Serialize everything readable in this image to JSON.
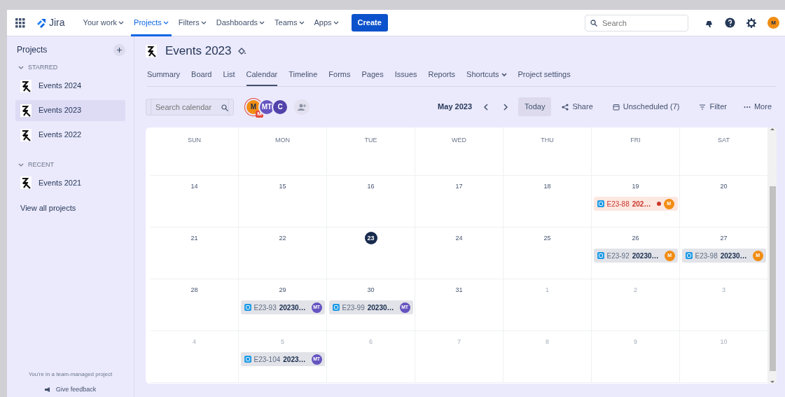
{
  "topnav": {
    "product": "Jira",
    "items": [
      {
        "label": "Your work",
        "selected": false
      },
      {
        "label": "Projects",
        "selected": true
      },
      {
        "label": "Filters",
        "selected": false
      },
      {
        "label": "Dashboards",
        "selected": false
      },
      {
        "label": "Teams",
        "selected": false
      },
      {
        "label": "Apps",
        "selected": false
      }
    ],
    "create": "Create",
    "search": {
      "placeholder": "Search"
    },
    "avatar": "M"
  },
  "sidebar": {
    "title": "Projects",
    "sections": [
      {
        "label": "STARRED",
        "expanded": true,
        "items": [
          {
            "label": "Events 2024",
            "selected": false
          },
          {
            "label": "Events 2023",
            "selected": true
          },
          {
            "label": "Events 2022",
            "selected": false
          }
        ]
      },
      {
        "label": "RECENT",
        "expanded": true,
        "items": [
          {
            "label": "Events 2021",
            "selected": false
          }
        ]
      }
    ],
    "view_all": "View all projects",
    "footer_note": "You're in a team-managed project",
    "feedback": "Give feedback"
  },
  "project": {
    "title": "Events 2023",
    "tabs": [
      {
        "label": "Summary",
        "selected": false
      },
      {
        "label": "Board",
        "selected": false
      },
      {
        "label": "List",
        "selected": false
      },
      {
        "label": "Calendar",
        "selected": true
      },
      {
        "label": "Timeline",
        "selected": false
      },
      {
        "label": "Forms",
        "selected": false
      },
      {
        "label": "Pages",
        "selected": false
      },
      {
        "label": "Issues",
        "selected": false
      },
      {
        "label": "Reports",
        "selected": false
      },
      {
        "label": "Shortcuts",
        "selected": false,
        "dropdown": true
      },
      {
        "label": "Project settings",
        "selected": false
      }
    ]
  },
  "toolbar": {
    "search": {
      "placeholder": "Search calendar"
    },
    "avatars": [
      {
        "initials": "M",
        "color": "#f18d13",
        "badge": "M"
      },
      {
        "initials": "MT",
        "color": "#6554c0"
      },
      {
        "initials": "C",
        "color": "#5243aa"
      }
    ],
    "month": "May 2023",
    "today": "Today",
    "share": "Share",
    "unscheduled": "Unscheduled (7)",
    "filter": "Filter",
    "more": "More"
  },
  "calendar": {
    "weekdays": [
      "SUN",
      "MON",
      "TUE",
      "WED",
      "THU",
      "FRI",
      "SAT"
    ],
    "weeks": [
      [
        {
          "day": "14",
          "outside": false,
          "today": false
        },
        {
          "day": "15",
          "outside": false,
          "today": false
        },
        {
          "day": "16",
          "outside": false,
          "today": false
        },
        {
          "day": "17",
          "outside": false,
          "today": false
        },
        {
          "day": "18",
          "outside": false,
          "today": false
        },
        {
          "day": "19",
          "outside": false,
          "today": false,
          "events": [
            {
              "key": "E23-88",
              "summary": "202…",
              "overdue": true,
              "assignee": "M",
              "color": "#f18d13"
            }
          ]
        },
        {
          "day": "20",
          "outside": false,
          "today": false
        }
      ],
      [
        {
          "day": "21",
          "outside": false,
          "today": false
        },
        {
          "day": "22",
          "outside": false,
          "today": false
        },
        {
          "day": "23",
          "outside": false,
          "today": true
        },
        {
          "day": "24",
          "outside": false,
          "today": false
        },
        {
          "day": "25",
          "outside": false,
          "today": false
        },
        {
          "day": "26",
          "outside": false,
          "today": false,
          "events": [
            {
              "key": "E23-92",
              "summary": "20230…",
              "overdue": false,
              "assignee": "M",
              "color": "#f18d13"
            }
          ]
        },
        {
          "day": "27",
          "outside": false,
          "today": false,
          "events": [
            {
              "key": "E23-98",
              "summary": "20230…",
              "overdue": false,
              "assignee": "M",
              "color": "#f18d13"
            }
          ]
        }
      ],
      [
        {
          "day": "28",
          "outside": false,
          "today": false
        },
        {
          "day": "29",
          "outside": false,
          "today": false,
          "events": [
            {
              "key": "E23-93",
              "summary": "20230…",
              "overdue": false,
              "assignee": "MT",
              "color": "#6554c0"
            }
          ]
        },
        {
          "day": "30",
          "outside": false,
          "today": false,
          "events": [
            {
              "key": "E23-99",
              "summary": "20230…",
              "overdue": false,
              "assignee": "MT",
              "color": "#6554c0"
            }
          ]
        },
        {
          "day": "31",
          "outside": false,
          "today": false
        },
        {
          "day": "1",
          "outside": true,
          "today": false
        },
        {
          "day": "2",
          "outside": true,
          "today": false
        },
        {
          "day": "3",
          "outside": true,
          "today": false
        }
      ],
      [
        {
          "day": "4",
          "outside": true,
          "today": false
        },
        {
          "day": "5",
          "outside": true,
          "today": false,
          "events": [
            {
              "key": "E23-104",
              "summary": "2023…",
              "overdue": false,
              "assignee": "MT",
              "color": "#6554c0"
            }
          ]
        },
        {
          "day": "6",
          "outside": true,
          "today": false
        },
        {
          "day": "7",
          "outside": true,
          "today": false
        },
        {
          "day": "8",
          "outside": true,
          "today": false
        },
        {
          "day": "9",
          "outside": true,
          "today": false
        },
        {
          "day": "10",
          "outside": true,
          "today": false
        }
      ]
    ]
  }
}
